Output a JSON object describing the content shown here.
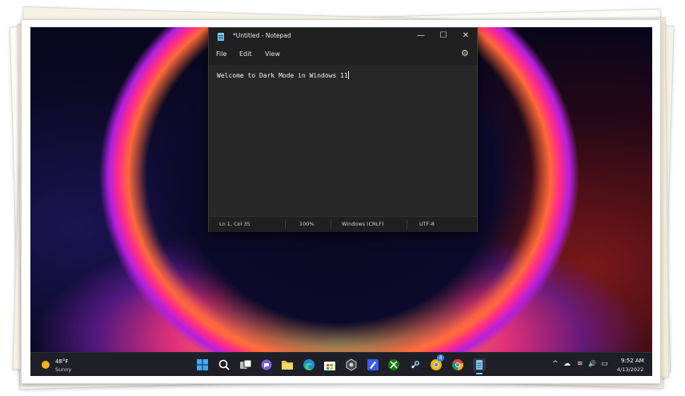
{
  "notepad": {
    "title": "*Untitled - Notepad",
    "menu": [
      "File",
      "Edit",
      "View"
    ],
    "content": "Welcome to Dark Mode in Windows 11",
    "status": {
      "position": "Ln 1, Col 35",
      "zoom": "100%",
      "line_ending": "Windows (CRLF)",
      "encoding": "UTF-8"
    },
    "window_buttons": {
      "minimize": "—",
      "maximize": "☐",
      "close": "✕"
    },
    "settings_glyph": "⚙"
  },
  "taskbar": {
    "weather": {
      "temp": "48°F",
      "condition": "Sunny"
    },
    "apps": [
      "start-icon",
      "search-icon",
      "task-view-icon",
      "chat-icon",
      "file-explorer-icon",
      "edge-icon",
      "store-icon",
      "app-icon",
      "paint-icon",
      "xbox-icon",
      "steam-icon",
      "chrome-canary-icon",
      "chrome-icon",
      "notepad-icon"
    ],
    "badge": "4",
    "clock": {
      "time": "9:52 AM",
      "date": "4/13/2022"
    },
    "tray_glyphs": {
      "chevron": "^",
      "cloud": "☁",
      "wifi": "≋",
      "volume": "🔊",
      "battery": "▭"
    }
  }
}
